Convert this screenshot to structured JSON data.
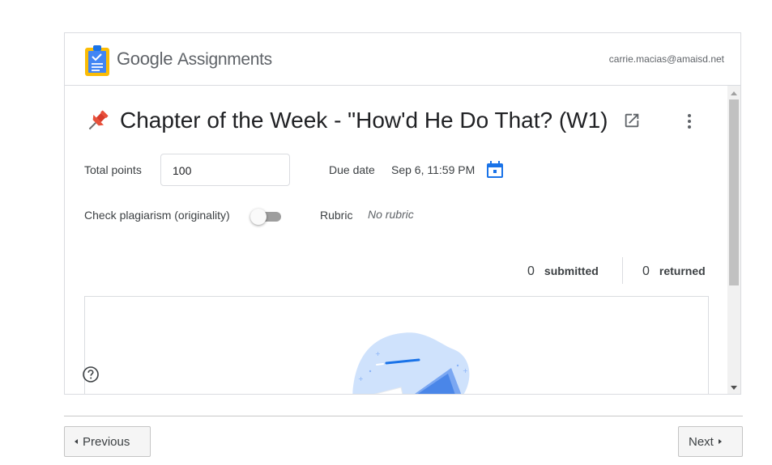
{
  "header": {
    "brand": "Google",
    "product": "Assignments",
    "user_email": "carrie.macias@amaisd.net"
  },
  "assignment": {
    "title": "Chapter of the Week - \"How'd He Do That? (W1)",
    "total_points_label": "Total points",
    "total_points_value": "100",
    "due_date_label": "Due date",
    "due_date_value": "Sep 6, 11:59 PM",
    "plagiarism_label": "Check plagiarism (originality)",
    "plagiarism_enabled": false,
    "rubric_label": "Rubric",
    "rubric_value": "No rubric"
  },
  "stats": {
    "submitted_count": "0",
    "submitted_label": "submitted",
    "returned_count": "0",
    "returned_label": "returned"
  },
  "icons": {
    "pin": "pushpin-icon",
    "open": "open-in-new-icon",
    "more": "more-vert-icon",
    "calendar": "calendar-icon",
    "help": "help-icon"
  },
  "colors": {
    "accent_blue": "#1a73e8",
    "pin_red": "#e8503a",
    "logo_yellow": "#fbbc04"
  },
  "nav": {
    "previous_label": "Previous",
    "next_label": "Next"
  }
}
